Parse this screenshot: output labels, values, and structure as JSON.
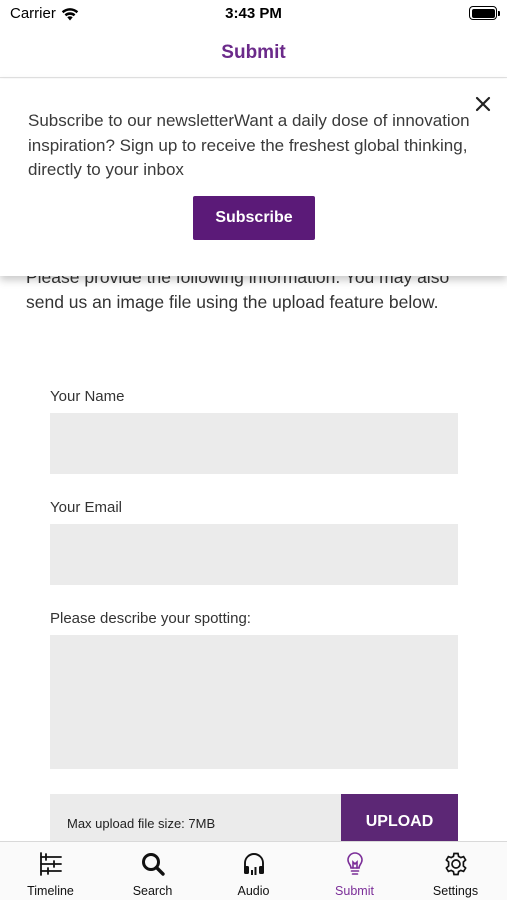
{
  "status_bar": {
    "carrier": "Carrier",
    "time": "3:43 PM"
  },
  "header": {
    "title": "Submit"
  },
  "popup": {
    "message": "Subscribe to our newsletterWant a daily dose of innovation inspiration? Sign up to receive the freshest global thinking, directly to your inbox",
    "subscribe_label": "Subscribe",
    "close_icon": "close-icon"
  },
  "main": {
    "intro": "Please provide the following information. You may also send us an image file using the upload feature below."
  },
  "form": {
    "name_label": "Your Name",
    "name_value": "",
    "email_label": "Your Email",
    "email_value": "",
    "description_label": "Please describe your spotting:",
    "description_value": "",
    "upload_hint": "Max upload file size: 7MB",
    "upload_label": "UPLOAD"
  },
  "tabs": [
    {
      "label": "Timeline",
      "icon": "sliders-icon",
      "active": false
    },
    {
      "label": "Search",
      "icon": "search-icon",
      "active": false
    },
    {
      "label": "Audio",
      "icon": "headphones-icon",
      "active": false
    },
    {
      "label": "Submit",
      "icon": "lightbulb-icon",
      "active": true
    },
    {
      "label": "Settings",
      "icon": "gear-icon",
      "active": false
    }
  ],
  "colors": {
    "accent": "#6b2a8a",
    "button": "#5b1a78",
    "field_background": "#ebebeb"
  }
}
